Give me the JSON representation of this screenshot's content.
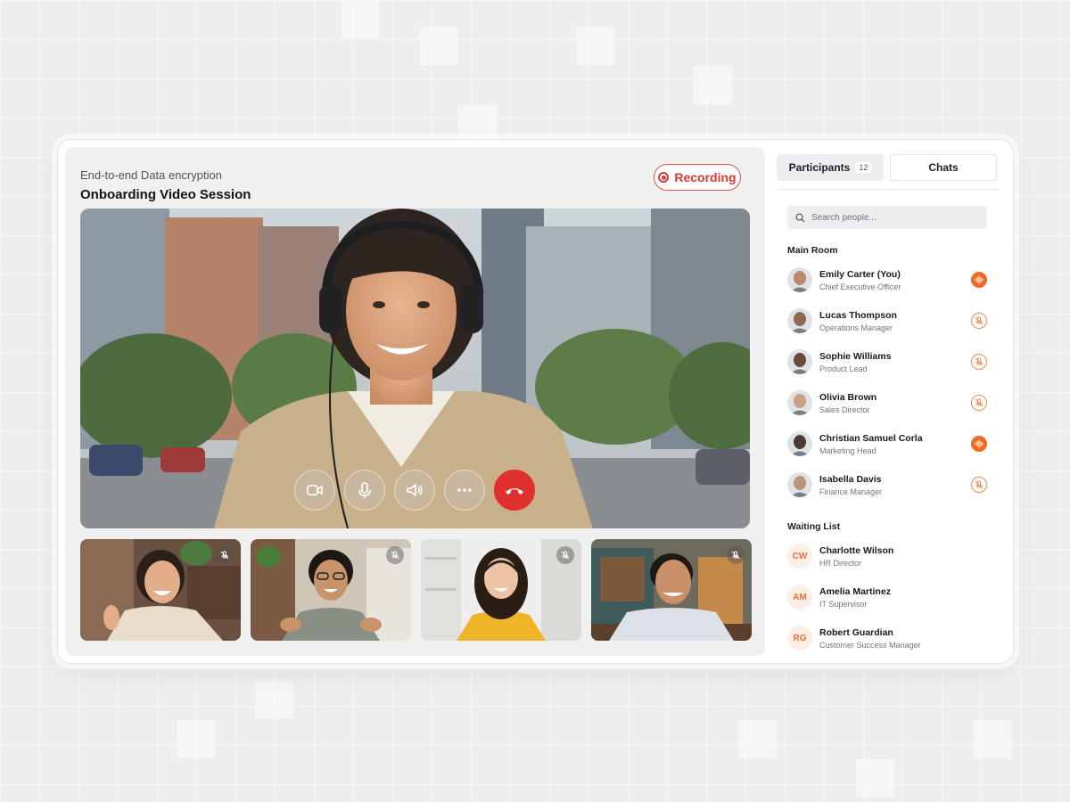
{
  "header": {
    "subtitle": "End-to-end Data encryption",
    "title": "Onboarding Video Session",
    "recording_label": "Recording"
  },
  "controls": [
    {
      "name": "camera-button",
      "icon": "camera-icon"
    },
    {
      "name": "microphone-button",
      "icon": "microphone-icon"
    },
    {
      "name": "speaker-button",
      "icon": "speaker-icon"
    },
    {
      "name": "more-options-button",
      "icon": "more-icon"
    },
    {
      "name": "end-call-button",
      "icon": "phone-hangup-icon"
    }
  ],
  "thumbnails": [
    {
      "icon": "mic-off-icon"
    },
    {
      "icon": "mic-off-icon"
    },
    {
      "icon": "mic-off-icon"
    },
    {
      "icon": "mic-off-icon"
    }
  ],
  "panel": {
    "tabs": [
      {
        "label": "Participants",
        "count": "12",
        "active": true
      },
      {
        "label": "Chats",
        "active": false
      }
    ],
    "search_placeholder": "Search people...",
    "main_room_label": "Main Room",
    "main_room": [
      {
        "name": "Emily Carter (You)",
        "role": "Chief Executive Officer",
        "status": "speaking"
      },
      {
        "name": "Lucas Thompson",
        "role": "Operations Manager",
        "status": "muted"
      },
      {
        "name": "Sophie Williams",
        "role": "Product Lead",
        "status": "muted"
      },
      {
        "name": "Olivia Brown",
        "role": "Sales Director",
        "status": "muted"
      },
      {
        "name": "Christian Samuel Corla",
        "role": "Marketing Head",
        "status": "speaking"
      },
      {
        "name": "Isabella Davis",
        "role": "Finance Manager",
        "status": "muted"
      }
    ],
    "waiting_list_label": "Waiting List",
    "waiting_list": [
      {
        "initials": "CW",
        "name": "Charlotte Wilson",
        "role": "HR Director"
      },
      {
        "initials": "AM",
        "name": "Amelia Martinez",
        "role": "IT Supervisor"
      },
      {
        "initials": "RG",
        "name": "Robert Guardian",
        "role": "Customer Success Manager"
      }
    ]
  },
  "colors": {
    "accent": "#f26a22",
    "recording": "#d63a33",
    "end_call": "#e0302b"
  }
}
